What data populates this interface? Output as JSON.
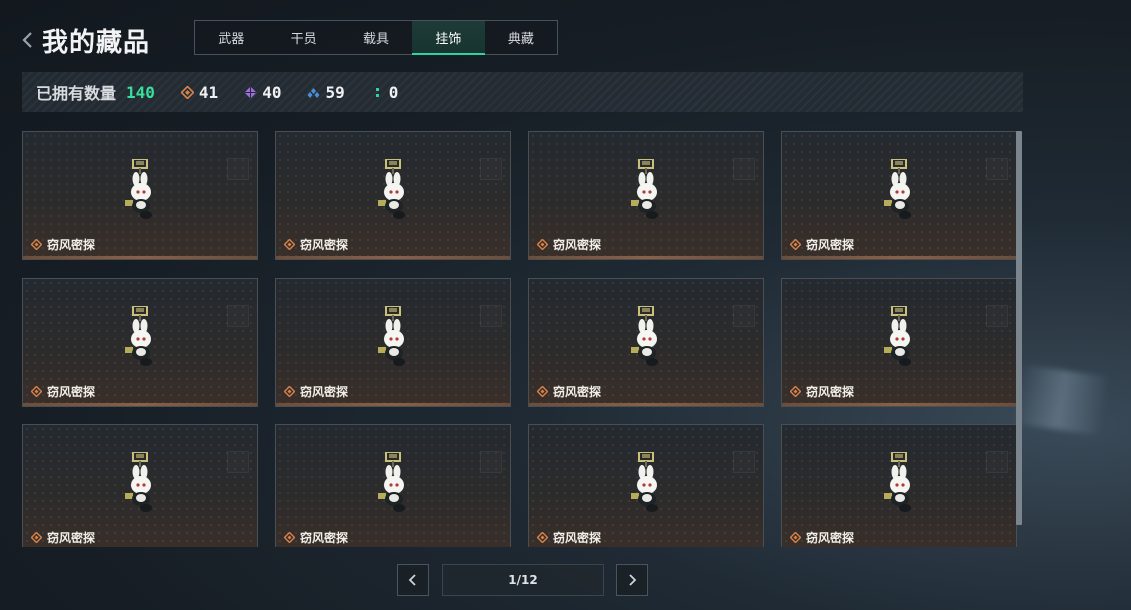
{
  "header": {
    "title": "我的藏品",
    "back_icon": "chevron-left-icon"
  },
  "tabs": [
    {
      "label": "武器",
      "active": false
    },
    {
      "label": "干员",
      "active": false
    },
    {
      "label": "载具",
      "active": false
    },
    {
      "label": "挂饰",
      "active": true
    },
    {
      "label": "典藏",
      "active": false
    }
  ],
  "stats": {
    "owned_label": "已拥有数量",
    "owned_total": "140",
    "total_color": "#37e09a",
    "rarities": [
      {
        "icon": "orange-diamond-icon",
        "color": "#d9824a",
        "value": "41"
      },
      {
        "icon": "purple-diamond-icon",
        "color": "#9a6fd6",
        "value": "40"
      },
      {
        "icon": "blue-cluster-icon",
        "color": "#4a8fd9",
        "value": "59"
      },
      {
        "icon": "green-dots-icon",
        "color": "#2fd3a0",
        "value": "0"
      }
    ]
  },
  "items": [
    {
      "name": "窃风密探",
      "rarity_color": "#d9824a",
      "icon": "bunny-charm-icon"
    },
    {
      "name": "窃风密探",
      "rarity_color": "#d9824a",
      "icon": "bunny-charm-icon"
    },
    {
      "name": "窃风密探",
      "rarity_color": "#d9824a",
      "icon": "bunny-charm-icon"
    },
    {
      "name": "窃风密探",
      "rarity_color": "#d9824a",
      "icon": "bunny-charm-icon"
    },
    {
      "name": "窃风密探",
      "rarity_color": "#d9824a",
      "icon": "bunny-charm-icon"
    },
    {
      "name": "窃风密探",
      "rarity_color": "#d9824a",
      "icon": "bunny-charm-icon"
    },
    {
      "name": "窃风密探",
      "rarity_color": "#d9824a",
      "icon": "bunny-charm-icon"
    },
    {
      "name": "窃风密探",
      "rarity_color": "#d9824a",
      "icon": "bunny-charm-icon"
    },
    {
      "name": "窃风密探",
      "rarity_color": "#d9824a",
      "icon": "bunny-charm-icon"
    },
    {
      "name": "窃风密探",
      "rarity_color": "#d9824a",
      "icon": "bunny-charm-icon"
    },
    {
      "name": "窃风密探",
      "rarity_color": "#d9824a",
      "icon": "bunny-charm-icon"
    },
    {
      "name": "窃风密探",
      "rarity_color": "#d9824a",
      "icon": "bunny-charm-icon"
    }
  ],
  "pagination": {
    "indicator": "1/12",
    "prev_icon": "chevron-left-icon",
    "next_icon": "chevron-right-icon"
  }
}
